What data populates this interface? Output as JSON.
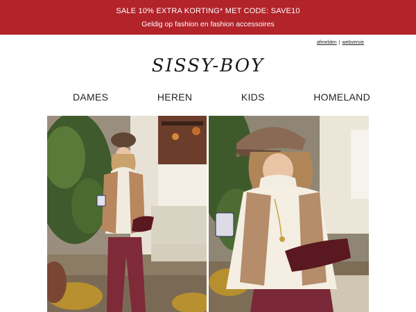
{
  "promo": {
    "line1": "SALE 10% EXTRA KORTING* MET CODE: SAVE10",
    "line2": "Geldig op fashion en fashion accessoires",
    "bg": "#b2232a"
  },
  "toplinks": {
    "unsubscribe": "afmelden",
    "separator": "|",
    "webversion": "webversie"
  },
  "brand": {
    "logo": "SISSY-BOY"
  },
  "nav": {
    "items": [
      "DAMES",
      "HEREN",
      "KIDS",
      "HOMELAND"
    ]
  }
}
